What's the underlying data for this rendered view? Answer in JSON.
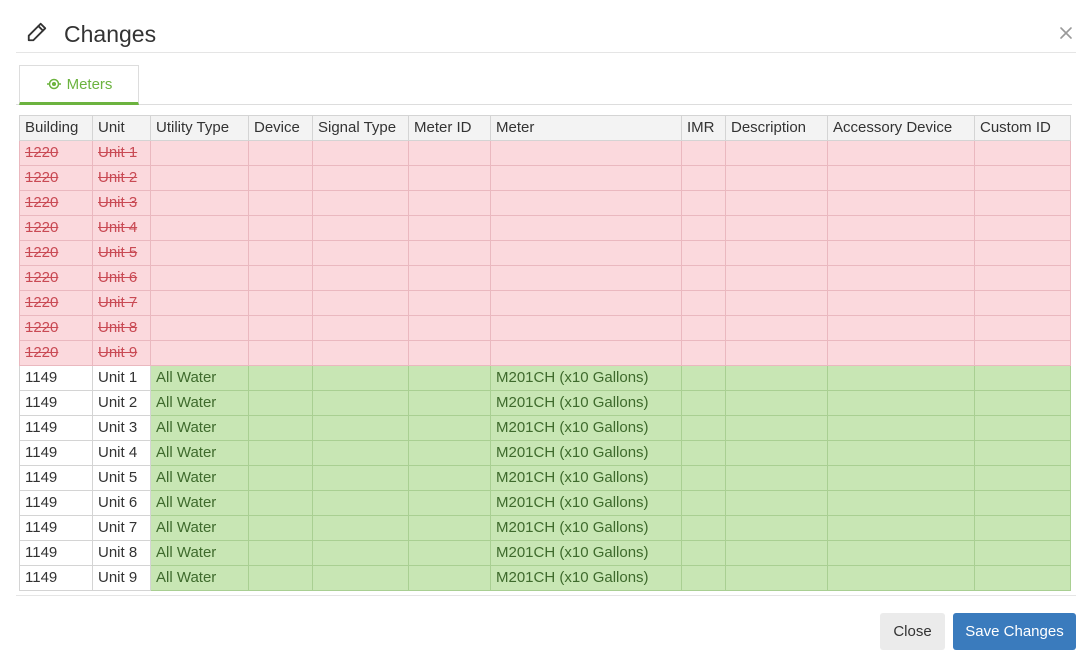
{
  "dialog": {
    "title": "Changes",
    "title_icon": "pencil-icon",
    "close_icon": "close-icon"
  },
  "tabs": [
    {
      "label": "Meters",
      "icon": "meter-icon",
      "active": true
    }
  ],
  "table": {
    "columns": [
      "Building",
      "Unit",
      "Utility Type",
      "Device",
      "Signal Type",
      "Meter ID",
      "Meter",
      "IMR",
      "Description",
      "Accessory Device",
      "Custom ID"
    ],
    "removed_rows": [
      [
        "1220",
        "Unit 1",
        "",
        "",
        "",
        "",
        "",
        "",
        "",
        "",
        ""
      ],
      [
        "1220",
        "Unit 2",
        "",
        "",
        "",
        "",
        "",
        "",
        "",
        "",
        ""
      ],
      [
        "1220",
        "Unit 3",
        "",
        "",
        "",
        "",
        "",
        "",
        "",
        "",
        ""
      ],
      [
        "1220",
        "Unit 4",
        "",
        "",
        "",
        "",
        "",
        "",
        "",
        "",
        ""
      ],
      [
        "1220",
        "Unit 5",
        "",
        "",
        "",
        "",
        "",
        "",
        "",
        "",
        ""
      ],
      [
        "1220",
        "Unit 6",
        "",
        "",
        "",
        "",
        "",
        "",
        "",
        "",
        ""
      ],
      [
        "1220",
        "Unit 7",
        "",
        "",
        "",
        "",
        "",
        "",
        "",
        "",
        ""
      ],
      [
        "1220",
        "Unit 8",
        "",
        "",
        "",
        "",
        "",
        "",
        "",
        "",
        ""
      ],
      [
        "1220",
        "Unit 9",
        "",
        "",
        "",
        "",
        "",
        "",
        "",
        "",
        ""
      ]
    ],
    "added_rows": [
      [
        "1149",
        "Unit 1",
        "All Water",
        "",
        "",
        "",
        "M201CH (x10 Gallons)",
        "",
        "",
        "",
        ""
      ],
      [
        "1149",
        "Unit 2",
        "All Water",
        "",
        "",
        "",
        "M201CH (x10 Gallons)",
        "",
        "",
        "",
        ""
      ],
      [
        "1149",
        "Unit 3",
        "All Water",
        "",
        "",
        "",
        "M201CH (x10 Gallons)",
        "",
        "",
        "",
        ""
      ],
      [
        "1149",
        "Unit 4",
        "All Water",
        "",
        "",
        "",
        "M201CH (x10 Gallons)",
        "",
        "",
        "",
        ""
      ],
      [
        "1149",
        "Unit 5",
        "All Water",
        "",
        "",
        "",
        "M201CH (x10 Gallons)",
        "",
        "",
        "",
        ""
      ],
      [
        "1149",
        "Unit 6",
        "All Water",
        "",
        "",
        "",
        "M201CH (x10 Gallons)",
        "",
        "",
        "",
        ""
      ],
      [
        "1149",
        "Unit 7",
        "All Water",
        "",
        "",
        "",
        "M201CH (x10 Gallons)",
        "",
        "",
        "",
        ""
      ],
      [
        "1149",
        "Unit 8",
        "All Water",
        "",
        "",
        "",
        "M201CH (x10 Gallons)",
        "",
        "",
        "",
        ""
      ],
      [
        "1149",
        "Unit 9",
        "All Water",
        "",
        "",
        "",
        "M201CH (x10 Gallons)",
        "",
        "",
        "",
        ""
      ]
    ]
  },
  "footer": {
    "close_label": "Close",
    "save_label": "Save Changes"
  },
  "colors": {
    "removed_row_bg": "#fbd9dd",
    "removed_text": "#c94a54",
    "added_row_bg": "#c8e6b4",
    "tab_accent": "#6cb33f",
    "primary_button": "#3a7bbd"
  }
}
